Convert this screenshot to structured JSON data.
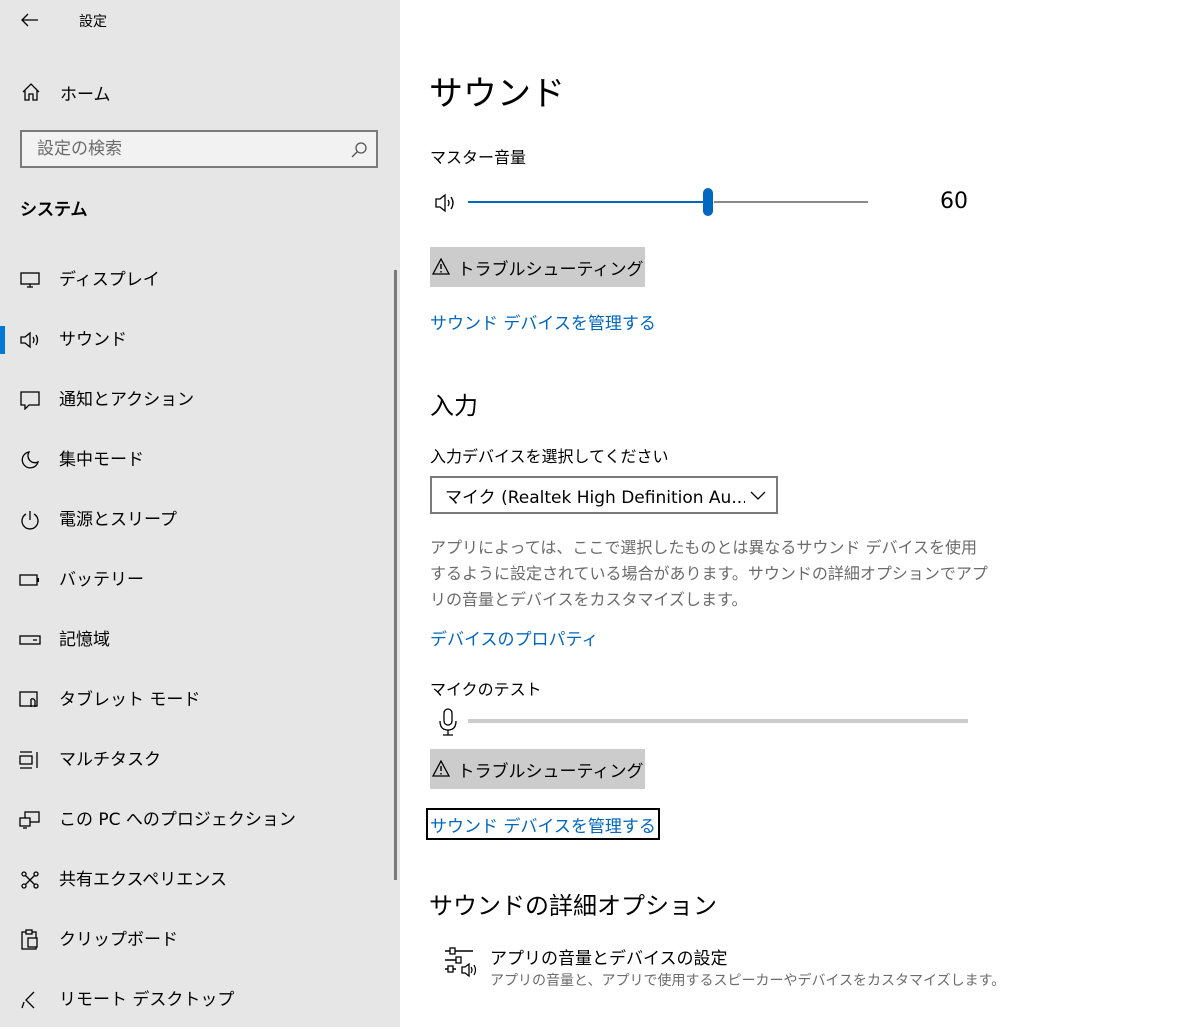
{
  "window": {
    "title": "設定"
  },
  "sidebar": {
    "home_label": "ホーム",
    "search_placeholder": "設定の検索",
    "section_title": "システム",
    "items": [
      {
        "label": "ディスプレイ",
        "icon": "display-icon"
      },
      {
        "label": "サウンド",
        "icon": "speaker-icon",
        "active": true
      },
      {
        "label": "通知とアクション",
        "icon": "notification-icon"
      },
      {
        "label": "集中モード",
        "icon": "moon-icon"
      },
      {
        "label": "電源とスリープ",
        "icon": "power-icon"
      },
      {
        "label": "バッテリー",
        "icon": "battery-icon"
      },
      {
        "label": "記憶域",
        "icon": "storage-icon"
      },
      {
        "label": "タブレット モード",
        "icon": "tablet-icon"
      },
      {
        "label": "マルチタスク",
        "icon": "multitask-icon"
      },
      {
        "label": "この PC へのプロジェクション",
        "icon": "projection-icon"
      },
      {
        "label": "共有エクスペリエンス",
        "icon": "shared-experience-icon"
      },
      {
        "label": "クリップボード",
        "icon": "clipboard-icon"
      },
      {
        "label": "リモート デスクトップ",
        "icon": "remote-desktop-icon"
      }
    ]
  },
  "main": {
    "title": "サウンド",
    "master_volume_label": "マスター音量",
    "volume": {
      "value": 60,
      "display": "60"
    },
    "troubleshoot_label": "トラブルシューティング",
    "manage_devices_link": "サウンド デバイスを管理する",
    "input_heading": "入力",
    "input_select_label": "入力デバイスを選択してください",
    "input_device_value": "マイク (Realtek High Definition Au...",
    "input_description": "アプリによっては、ここで選択したものとは異なるサウンド デバイスを使用するように設定されている場合があります。サウンドの詳細オプションでアプリの音量とデバイスをカスタマイズします。",
    "device_properties_link": "デバイスのプロパティ",
    "mic_test_label": "マイクのテスト",
    "mic_level": 0,
    "troubleshoot2_label": "トラブルシューティング",
    "manage_devices_link2": "サウンド デバイスを管理する",
    "advanced_heading": "サウンドの詳細オプション",
    "advanced_item_title": "アプリの音量とデバイスの設定",
    "advanced_item_desc": "アプリの音量と、アプリで使用するスピーカーやデバイスをカスタマイズします。"
  },
  "colors": {
    "accent": "#0067c0",
    "sidebar_bg": "#e6e6e6",
    "button_bg": "#cccccc"
  }
}
